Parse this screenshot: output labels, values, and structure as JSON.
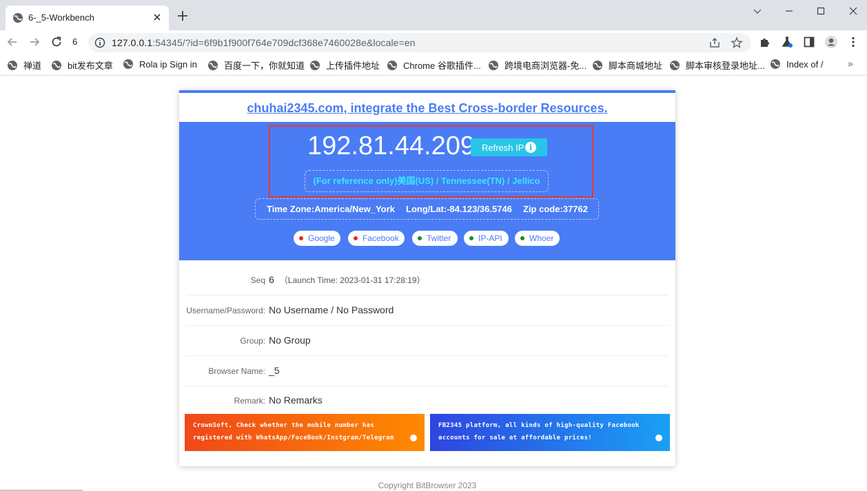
{
  "browser": {
    "tab_title": "6-_5-Workbench",
    "tab_number": "6",
    "url_host": "127.0.0.1",
    "url_rest": ":54345/?id=6f9b1f900f764e709dcf368e7460028e&locale=en",
    "bookmarks": [
      "禅道",
      "bit发布文章",
      "Rola ip Sign in",
      "百度一下，你就知道",
      "上传插件地址",
      "Chrome 谷歌插件...",
      "跨境电商浏览器-免...",
      "脚本商城地址",
      "脚本审核登录地址...",
      "Index of /"
    ],
    "bookmarks_more": "»"
  },
  "page": {
    "headline": "chuhai2345.com, integrate the Best Cross-border Resources.",
    "ip": "192.81.44.209",
    "refresh_label": "Refresh IP",
    "geo": "(For reference only)美国(US) / Tennessee(TN) / Jellico",
    "timezone": "Time Zone:America/New_York",
    "longlat": "Long/Lat:-84.123/36.5746",
    "zip": "Zip code:37762",
    "checks": [
      {
        "label": "Google",
        "dot": "#e8262b"
      },
      {
        "label": "Facebook",
        "dot": "#e8262b"
      },
      {
        "label": "Twitter",
        "dot": "#1a8a2e"
      },
      {
        "label": "IP-API",
        "dot": "#1a8a2e"
      },
      {
        "label": "Whoer",
        "dot": "#1a8a2e"
      }
    ],
    "details": {
      "seq_label": "Seq",
      "seq_value": "6",
      "launch_time": "（Launch Time: 2023-01-31 17:28:19）",
      "user_label": "Username/Password:",
      "user_value": "No Username / No Password",
      "group_label": "Group:",
      "group_value": "No Group",
      "browser_label": "Browser Name:",
      "browser_value": "_5",
      "remark_label": "Remark:",
      "remark_value": "No Remarks"
    },
    "banners": [
      {
        "text": "CrownSoft, Check whether the mobile number has registered with WhatsApp/FaceBook/Instgram/Telegram"
      },
      {
        "text": "FB2345 platform, all kinds of high-quality Facebook accounts for sale at affordable prices!"
      }
    ],
    "copyright": "Copyright BitBrowser 2023"
  },
  "colors": {
    "accent": "#4a7cf5",
    "refresh_button": "#29c5e8",
    "highlight_border": "#e8392f"
  }
}
